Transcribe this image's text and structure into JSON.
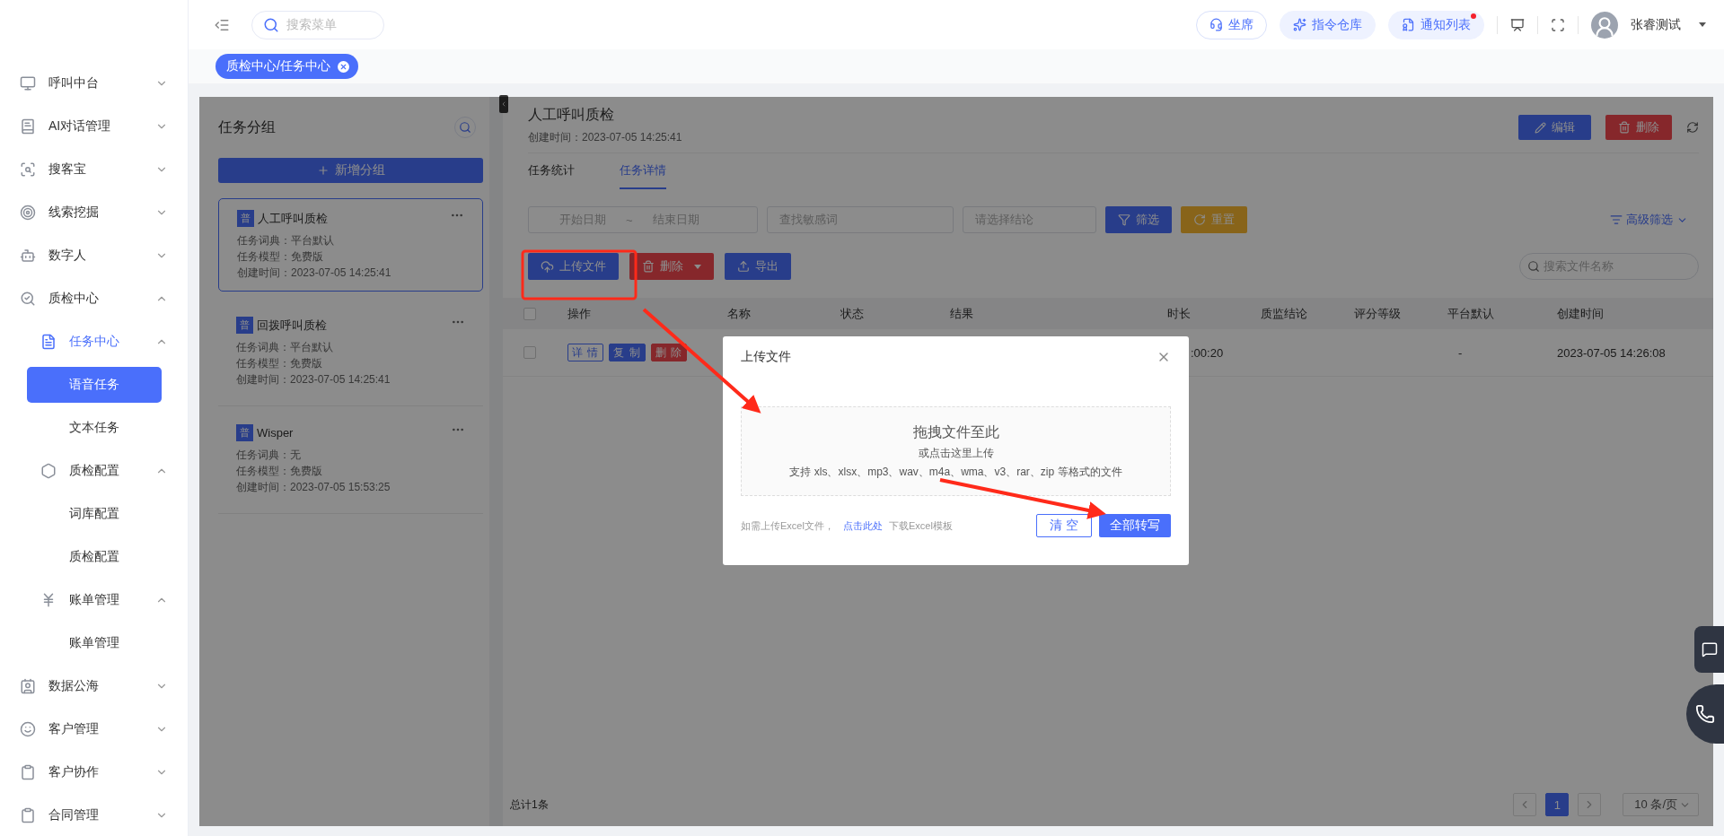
{
  "sidebar": {
    "items": [
      {
        "label": "呼叫中台",
        "expanded": false,
        "selected": false
      },
      {
        "label": "AI对话管理",
        "expanded": false,
        "selected": false
      },
      {
        "label": "搜客宝",
        "expanded": false,
        "selected": false
      },
      {
        "label": "线索挖掘",
        "expanded": false,
        "selected": false
      },
      {
        "label": "数字人",
        "expanded": false,
        "selected": false
      },
      {
        "label": "质检中心",
        "expanded": true,
        "selected": false,
        "children": [
          {
            "label": "任务中心",
            "expanded": true,
            "selected": true,
            "children": [
              {
                "label": "语音任务",
                "selected": true
              },
              {
                "label": "文本任务",
                "selected": false
              }
            ]
          },
          {
            "label": "质检配置",
            "expanded": true,
            "selected": false,
            "children": [
              {
                "label": "词库配置",
                "selected": false
              },
              {
                "label": "质检配置",
                "selected": false
              }
            ]
          },
          {
            "label": "账单管理",
            "expanded": true,
            "selected": false,
            "children": [
              {
                "label": "账单管理",
                "selected": false
              }
            ]
          }
        ]
      },
      {
        "label": "数据公海",
        "expanded": false,
        "selected": false
      },
      {
        "label": "客户管理",
        "expanded": false,
        "selected": false
      },
      {
        "label": "客户协作",
        "expanded": false,
        "selected": false
      },
      {
        "label": "合同管理",
        "expanded": false,
        "selected": false
      }
    ]
  },
  "top_bar": {
    "search": {
      "placeholder": "搜索菜单"
    },
    "buttons": [
      {
        "label": "坐席",
        "kind": "outline",
        "unread": false
      },
      {
        "label": "指令仓库",
        "kind": "soft",
        "unread": false
      },
      {
        "label": "通知列表",
        "kind": "soft",
        "unread": true
      }
    ],
    "user": "张睿测试"
  },
  "tabs": [
    {
      "label": "质检中心/任务中心",
      "selected": true
    }
  ],
  "groups": {
    "title": "任务分组",
    "add_button": "新增分组",
    "items": [
      {
        "badge": "普",
        "name": "人工呼叫质检",
        "lines": [
          "任务词典：平台默认",
          "任务模型：免费版",
          "创建时间：2023-07-05 14:25:41"
        ],
        "selected": true
      },
      {
        "badge": "普",
        "name": "回拨呼叫质检",
        "lines": [
          "任务词典：平台默认",
          "任务模型：免费版",
          "创建时间：2023-07-05 14:25:41"
        ],
        "selected": false
      },
      {
        "badge": "普",
        "name": "Wisper",
        "lines": [
          "任务词典：无",
          "任务模型：免费版",
          "创建时间：2023-07-05 15:53:25"
        ],
        "selected": false
      }
    ]
  },
  "task": {
    "title": "人工呼叫质检",
    "created": "创建时间：2023-07-05 14:25:41",
    "edit_button": "编辑",
    "delete_button": "删除",
    "tabs": [
      {
        "label": "任务统计",
        "selected": false
      },
      {
        "label": "任务详情",
        "selected": true
      }
    ],
    "filters": {
      "start_date": "开始日期",
      "separator": "~",
      "end_date": "结束日期",
      "keyword": "查找敏感词",
      "conclusion": "请选择结论",
      "filter_button": "筛选",
      "reset_button": "重置",
      "advanced": "高级筛选"
    },
    "actions": {
      "upload": "上传文件",
      "delete": "删除",
      "export": "导出",
      "search": "搜索文件名称"
    },
    "table": {
      "columns": [
        "操作",
        "名称",
        "状态",
        "结果",
        "时长",
        "质监结论",
        "评分等级",
        "平台默认",
        "创建时间"
      ],
      "all_checked": false,
      "rows": [
        {
          "checked": false,
          "actions": [
            "详 情",
            "复 制",
            "删 除"
          ],
          "cells": [
            "",
            "",
            "",
            "",
            ":00:20",
            "",
            "",
            "-",
            "2023-07-05 14:26:08"
          ]
        }
      ]
    },
    "footer": {
      "total": "总计1条",
      "pages": [
        {
          "label": "1",
          "selected": true
        }
      ],
      "page_size": "10 条/页"
    }
  },
  "dialog": {
    "title": "上传文件",
    "drop_title": "拖拽文件至此",
    "drop_hint": "或点击这里上传",
    "formats": "支持 xls、xlsx、mp3、wav、m4a、wma、v3、rar、zip 等格式的文件",
    "note_before": "如需上传Excel文件，",
    "note_link": "点击此处",
    "note_after": " 下载Excel模板",
    "clear_button": "清 空",
    "submit_button": "全部转写"
  }
}
